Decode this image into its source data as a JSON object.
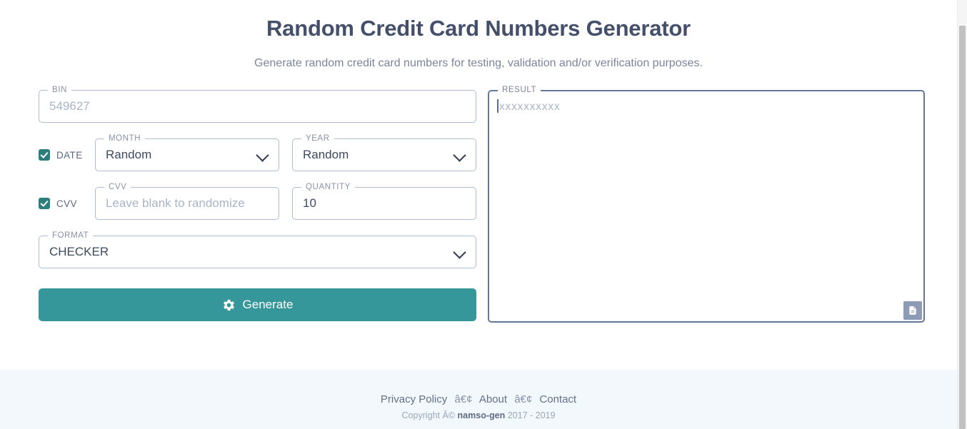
{
  "header": {
    "title": "Random Credit Card Numbers Generator",
    "subtitle": "Generate random credit card numbers for testing, validation and/or verification purposes."
  },
  "form": {
    "bin": {
      "legend": "BIN",
      "value": "",
      "placeholder": "549627"
    },
    "date": {
      "checkbox_label": "DATE",
      "checked": true,
      "month": {
        "legend": "MONTH",
        "selected": "Random"
      },
      "year": {
        "legend": "YEAR",
        "selected": "Random"
      }
    },
    "cvv": {
      "checkbox_label": "CVV",
      "checked": true,
      "input": {
        "legend": "CVV",
        "value": "",
        "placeholder": "Leave blank to randomize"
      },
      "quantity": {
        "legend": "QUANTITY",
        "value": "10"
      }
    },
    "format": {
      "legend": "FORMAT",
      "selected": "CHECKER"
    },
    "generate_button": {
      "label": "Generate",
      "icon": "gear-icon"
    }
  },
  "result": {
    "legend": "RESULT",
    "placeholder": "xxxxxxxxxx",
    "copy_icon": "copy-document-icon"
  },
  "footer": {
    "links": [
      {
        "label": "Privacy Policy"
      },
      {
        "label": "About"
      },
      {
        "label": "Contact"
      }
    ],
    "separator": "â€¢",
    "copyright_prefix": "Copyright Â©",
    "brand": "namso-gen",
    "years": "2017 - 2019"
  },
  "colors": {
    "accent_teal": "#35979a",
    "checkbox_teal": "#2d7d7d",
    "title": "#44506b",
    "border": "#aebbd0",
    "border_focus": "#667899",
    "placeholder": "#a9b4c7",
    "footer_bg": "#f3f8fc"
  }
}
